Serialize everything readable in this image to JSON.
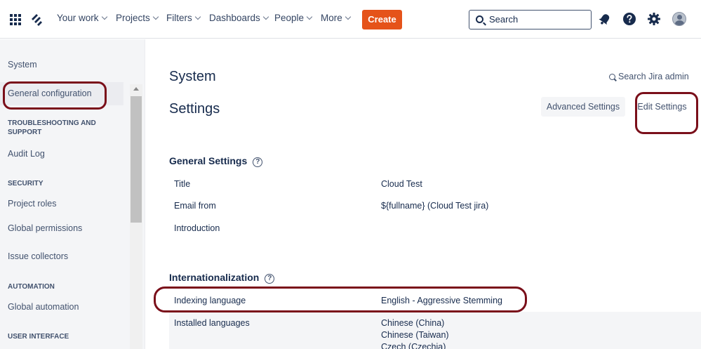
{
  "topnav": {
    "app_switcher_icon": "grid-icon",
    "logo_icon": "jira-logo-icon",
    "items": [
      "Your work",
      "Projects",
      "Filters",
      "Dashboards",
      "People",
      "More"
    ],
    "create_label": "Create",
    "search_placeholder": "Search",
    "notifications_icon": "bell-icon",
    "help_icon": "help-icon",
    "settings_icon": "gear-icon",
    "profile_icon": "avatar"
  },
  "sidebar": {
    "title": "System",
    "active_item": "General configuration",
    "sections": [
      {
        "heading": "TROUBLESHOOTING AND SUPPORT",
        "items": [
          "Audit Log"
        ]
      },
      {
        "heading": "SECURITY",
        "items": [
          "Project roles",
          "Global permissions",
          "Issue collectors"
        ]
      },
      {
        "heading": "AUTOMATION",
        "items": [
          "Global automation"
        ]
      },
      {
        "heading": "USER INTERFACE",
        "items": []
      }
    ]
  },
  "main": {
    "title": "System",
    "subtitle": "Settings",
    "search_admin": "Search Jira admin",
    "advanced_settings_label": "Advanced Settings",
    "edit_settings_label": "Edit Settings",
    "general": {
      "heading": "General Settings",
      "rows": [
        {
          "label": "Title",
          "value": "Cloud Test"
        },
        {
          "label": "Email from",
          "value": "${fullname} (Cloud Test jira)"
        },
        {
          "label": "Introduction",
          "value": ""
        }
      ]
    },
    "i18n": {
      "heading": "Internationalization",
      "indexing_label": "Indexing language",
      "indexing_value": "English - Aggressive Stemming",
      "installed_label": "Installed languages",
      "installed_values": [
        "Chinese (China)",
        "Chinese (Taiwan)",
        "Czech (Czechia)"
      ]
    }
  },
  "colors": {
    "create_button": "#e5531a",
    "annotation": "#7a0f1a",
    "text_primary": "#172b4d",
    "sidebar_bg": "#f4f5f7"
  }
}
